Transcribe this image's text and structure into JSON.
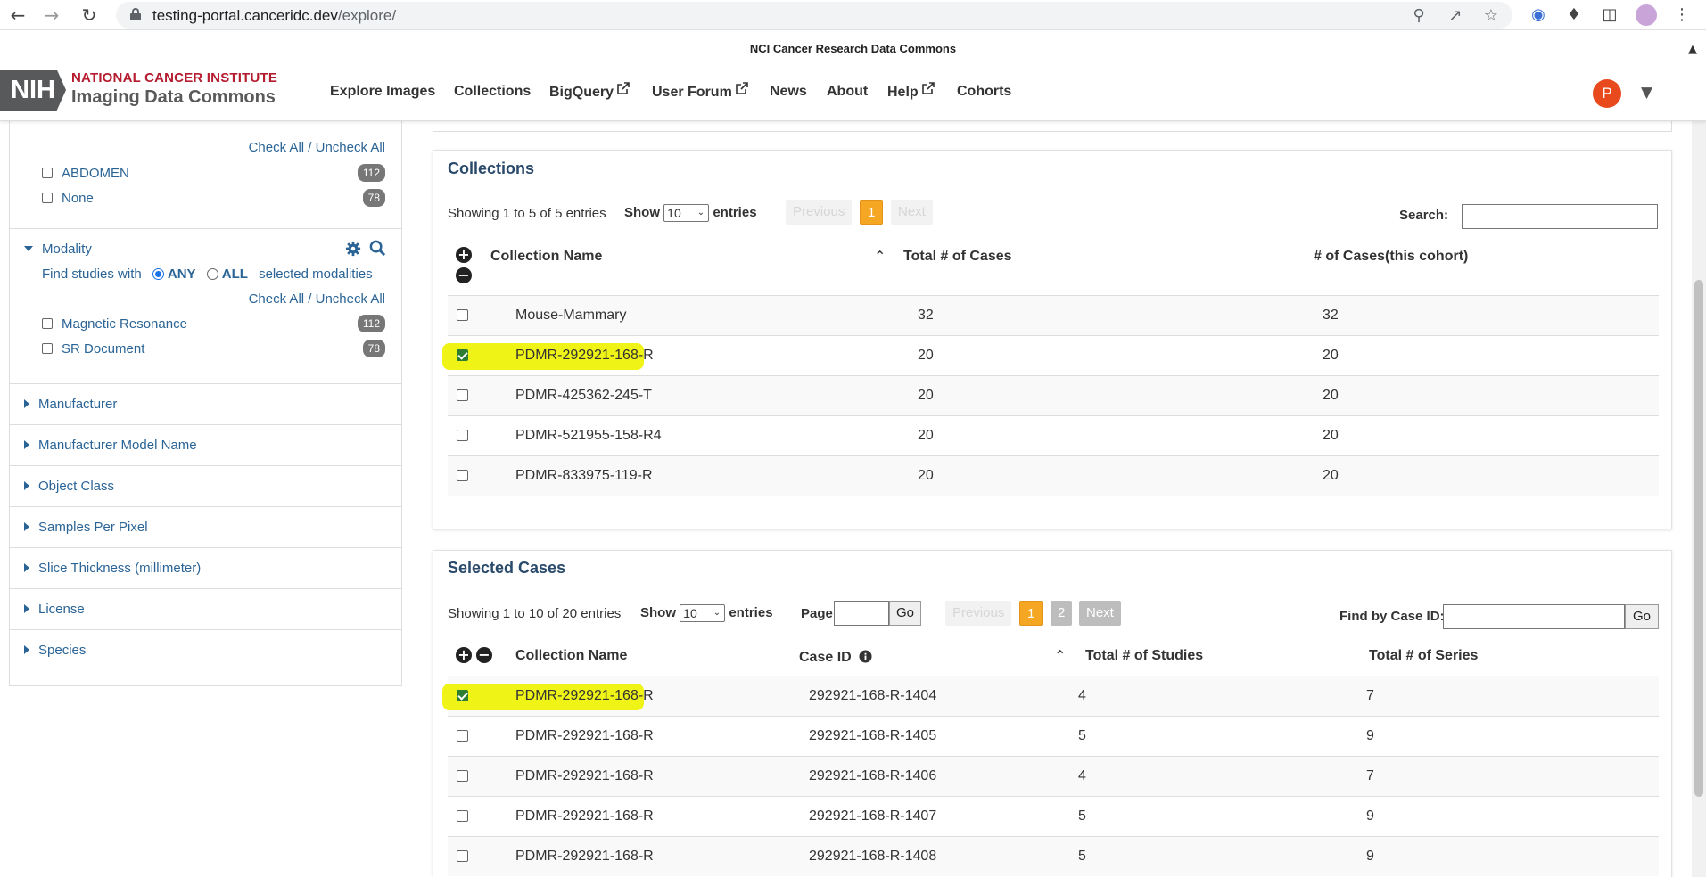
{
  "browser": {
    "url_host": "testing-portal.canceridc.dev",
    "url_path": "/explore/"
  },
  "banner": {
    "text": "NCI Cancer Research Data Commons"
  },
  "header": {
    "logo_abbr": "NIH",
    "logo_line1": "NATIONAL CANCER INSTITUTE",
    "logo_line2": "Imaging Data Commons",
    "nav": [
      {
        "label": "Explore Images",
        "external": false
      },
      {
        "label": "Collections",
        "external": false
      },
      {
        "label": "BigQuery",
        "external": true
      },
      {
        "label": "User Forum",
        "external": true
      },
      {
        "label": "News",
        "external": false
      },
      {
        "label": "About",
        "external": false
      },
      {
        "label": "Help",
        "external": true
      },
      {
        "label": "Cohorts",
        "external": false
      }
    ],
    "user_initial": "P"
  },
  "sidebar": {
    "body_part": {
      "check_all": "Check All",
      "separator": " / ",
      "uncheck_all": "Uncheck All",
      "items": [
        {
          "label": "ABDOMEN",
          "count": "112"
        },
        {
          "label": "None",
          "count": "78"
        }
      ]
    },
    "modality": {
      "title": "Modality",
      "find_prefix": "Find studies with",
      "any_label": "ANY",
      "all_label": "ALL",
      "find_suffix": "selected modalities",
      "check_all": "Check All",
      "separator": " / ",
      "uncheck_all": "Uncheck All",
      "items": [
        {
          "label": "Magnetic Resonance",
          "count": "112"
        },
        {
          "label": "SR Document",
          "count": "78"
        }
      ]
    },
    "collapsed_facets": [
      "Manufacturer",
      "Manufacturer Model Name",
      "Object Class",
      "Samples Per Pixel",
      "Slice Thickness (millimeter)",
      "License",
      "Species"
    ]
  },
  "collections": {
    "title": "Collections",
    "showing": "Showing 1 to 5 of 5 entries",
    "show_label": "Show",
    "show_value": "10",
    "entries_label": "entries",
    "prev_label": "Previous",
    "page": "1",
    "next_label": "Next",
    "search_label": "Search:",
    "columns": [
      "Collection Name",
      "Total # of Cases",
      "# of Cases(this cohort)"
    ],
    "rows": [
      {
        "name": "Mouse-Mammary",
        "total": "32",
        "cohort": "32",
        "checked": false
      },
      {
        "name": "PDMR-292921-168-R",
        "total": "20",
        "cohort": "20",
        "checked": true
      },
      {
        "name": "PDMR-425362-245-T",
        "total": "20",
        "cohort": "20",
        "checked": false
      },
      {
        "name": "PDMR-521955-158-R4",
        "total": "20",
        "cohort": "20",
        "checked": false
      },
      {
        "name": "PDMR-833975-119-R",
        "total": "20",
        "cohort": "20",
        "checked": false
      }
    ]
  },
  "cases": {
    "title": "Selected Cases",
    "showing": "Showing 1 to 10 of 20 entries",
    "show_label": "Show",
    "show_value": "10",
    "entries_label": "entries",
    "page_label": "Page",
    "go_label": "Go",
    "prev_label": "Previous",
    "pages": [
      "1",
      "2"
    ],
    "next_label": "Next",
    "find_label": "Find by Case ID:",
    "find_go": "Go",
    "columns": [
      "Collection Name",
      "Case ID",
      "Total # of Studies",
      "Total # of Series"
    ],
    "rows": [
      {
        "collection": "PDMR-292921-168-R",
        "case_id": "292921-168-R-1404",
        "studies": "4",
        "series": "7",
        "checked": true
      },
      {
        "collection": "PDMR-292921-168-R",
        "case_id": "292921-168-R-1405",
        "studies": "5",
        "series": "9",
        "checked": false
      },
      {
        "collection": "PDMR-292921-168-R",
        "case_id": "292921-168-R-1406",
        "studies": "4",
        "series": "7",
        "checked": false
      },
      {
        "collection": "PDMR-292921-168-R",
        "case_id": "292921-168-R-1407",
        "studies": "5",
        "series": "9",
        "checked": false
      },
      {
        "collection": "PDMR-292921-168-R",
        "case_id": "292921-168-R-1408",
        "studies": "5",
        "series": "9",
        "checked": false
      }
    ]
  },
  "colors": {
    "highlight": "#eef20a",
    "accent_orange": "#f5a623",
    "link_blue": "#2a6496",
    "nih_red": "#b51c2f"
  }
}
